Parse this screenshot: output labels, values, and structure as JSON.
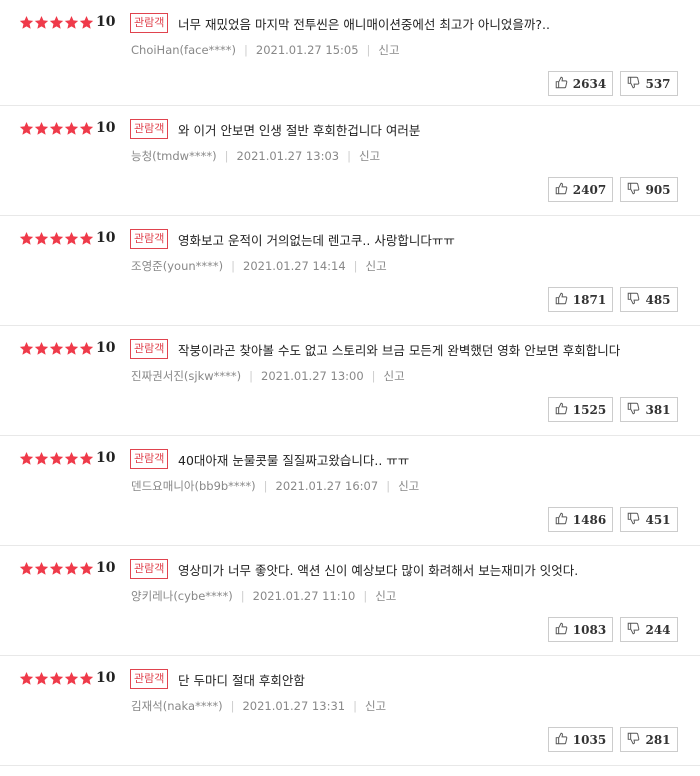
{
  "star_color": "#ef3a4a",
  "badge_color": "#e0434e",
  "reviews": [
    {
      "score": "10",
      "badge": "관람객",
      "text": "너무 재밌었음 마지막 전투씬은 애니매이션중에선 최고가 아니었을까?..",
      "author": "ChoiHan(face****)",
      "date": "2021.01.27 15:05",
      "report": "신고",
      "likes": "2634",
      "dislikes": "537"
    },
    {
      "score": "10",
      "badge": "관람객",
      "text": "와 이거 안보면 인생 절반 후회한겁니다 여러분",
      "author": "능청(tmdw****)",
      "date": "2021.01.27 13:03",
      "report": "신고",
      "likes": "2407",
      "dislikes": "905"
    },
    {
      "score": "10",
      "badge": "관람객",
      "text": "영화보고 운적이 거의없는데 렌고쿠.. 사랑합니다ㅠㅠ",
      "author": "조영준(youn****)",
      "date": "2021.01.27 14:14",
      "report": "신고",
      "likes": "1871",
      "dislikes": "485"
    },
    {
      "score": "10",
      "badge": "관람객",
      "text": "작붕이라곤 찾아볼 수도 없고 스토리와 브금 모든게 완벽했던 영화 안보면 후회합니다",
      "author": "진짜권서진(sjkw****)",
      "date": "2021.01.27 13:00",
      "report": "신고",
      "likes": "1525",
      "dislikes": "381"
    },
    {
      "score": "10",
      "badge": "관람객",
      "text": "40대아재 눈물콧물 질질짜고왔습니다.. ㅠㅠ",
      "author": "덴드요매니아(bb9b****)",
      "date": "2021.01.27 16:07",
      "report": "신고",
      "likes": "1486",
      "dislikes": "451"
    },
    {
      "score": "10",
      "badge": "관람객",
      "text": "영상미가 너무 좋앗다. 액션 신이 예상보다 많이 화려해서 보는재미가 잇엇다.",
      "author": "양키레나(cybe****)",
      "date": "2021.01.27 11:10",
      "report": "신고",
      "likes": "1083",
      "dislikes": "244"
    },
    {
      "score": "10",
      "badge": "관람객",
      "text": "단 두마디 절대 후회안함",
      "author": "김재석(naka****)",
      "date": "2021.01.27 13:31",
      "report": "신고",
      "likes": "1035",
      "dislikes": "281"
    }
  ]
}
